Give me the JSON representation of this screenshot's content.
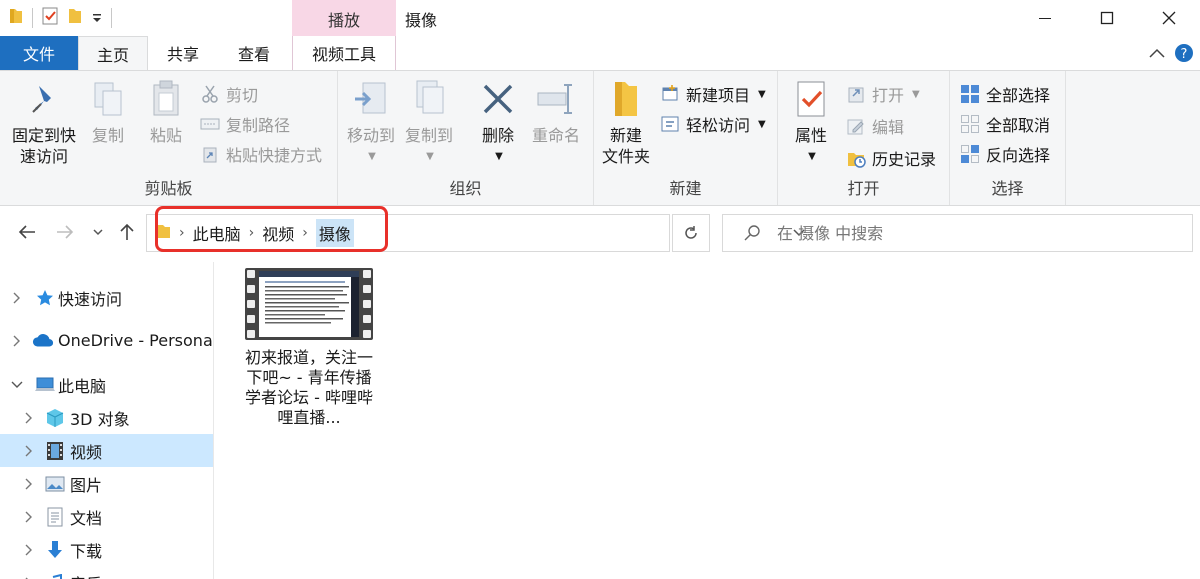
{
  "window": {
    "title": "摄像",
    "context_tab": "播放"
  },
  "tabs": {
    "file": "文件",
    "home": "主页",
    "share": "共享",
    "view": "查看",
    "video_tools": "视频工具"
  },
  "ribbon": {
    "clipboard": {
      "label": "剪贴板",
      "pin": "固定到快\n速访问",
      "pin_line1": "固定到快",
      "pin_line2": "速访问",
      "copy": "复制",
      "paste": "粘贴",
      "cut": "剪切",
      "copy_path": "复制路径",
      "paste_shortcut": "粘贴快捷方式"
    },
    "organize": {
      "label": "组织",
      "move_to": "移动到",
      "copy_to": "复制到",
      "delete": "删除",
      "rename": "重命名"
    },
    "new": {
      "label": "新建",
      "new_folder_line1": "新建",
      "new_folder_line2": "文件夹",
      "new_item": "新建项目",
      "easy_access": "轻松访问"
    },
    "open": {
      "label": "打开",
      "properties": "属性",
      "open": "打开",
      "edit": "编辑",
      "history": "历史记录"
    },
    "select": {
      "label": "选择",
      "select_all": "全部选择",
      "select_none": "全部取消",
      "invert": "反向选择"
    }
  },
  "address": {
    "crumbs": [
      "此电脑",
      "视频",
      "摄像"
    ],
    "search_placeholder": "在 摄像 中搜索"
  },
  "nav": {
    "items": [
      {
        "label": "快速访问"
      },
      {
        "label": "OneDrive - Persona"
      },
      {
        "label": "此电脑"
      },
      {
        "label": "3D 对象"
      },
      {
        "label": "视频"
      },
      {
        "label": "图片"
      },
      {
        "label": "文档"
      },
      {
        "label": "下载"
      },
      {
        "label": "音乐"
      }
    ]
  },
  "files": [
    {
      "name": "初来报道，关注一下吧~ - 青年传播学者论坛 - 哔哩哔哩直播..."
    }
  ],
  "colors": {
    "file_tab": "#1e6fc0",
    "context_tab": "#f8d7e6",
    "selection": "#cce8ff",
    "highlight_box": "#e8302a"
  }
}
